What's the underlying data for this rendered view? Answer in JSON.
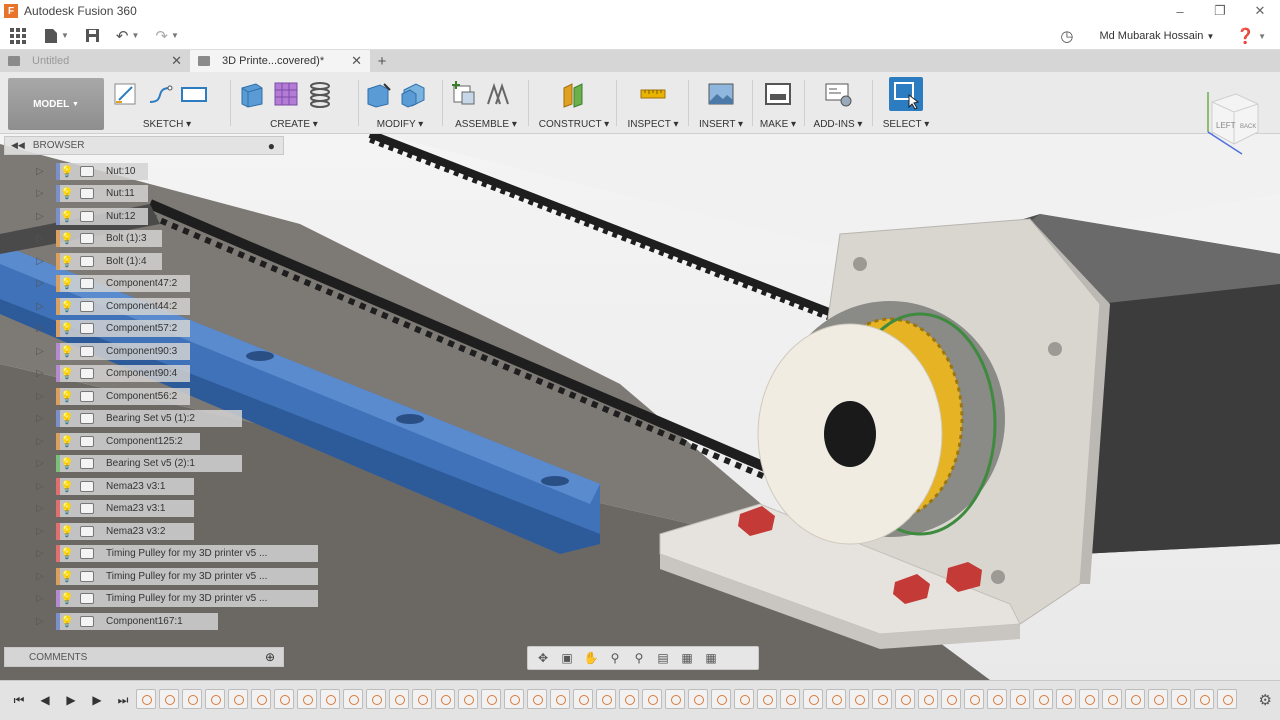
{
  "window": {
    "title": "Autodesk Fusion 360",
    "user_name": "Md Mubarak Hossain"
  },
  "tabs": [
    {
      "label": "Untitled",
      "active": false
    },
    {
      "label": "3D Printe...covered)*",
      "active": true
    }
  ],
  "ribbon": {
    "model_label": "MODEL",
    "groups": [
      {
        "label": "SKETCH"
      },
      {
        "label": "CREATE"
      },
      {
        "label": "MODIFY"
      },
      {
        "label": "ASSEMBLE"
      },
      {
        "label": "CONSTRUCT"
      },
      {
        "label": "INSPECT"
      },
      {
        "label": "INSERT"
      },
      {
        "label": "MAKE"
      },
      {
        "label": "ADD-INS"
      },
      {
        "label": "SELECT"
      }
    ]
  },
  "browser": {
    "title": "BROWSER",
    "items": [
      {
        "label": "Nut:10",
        "accent": "#7b90c8"
      },
      {
        "label": "Nut:11",
        "accent": "#7b90c8"
      },
      {
        "label": "Nut:12",
        "accent": "#7b90c8"
      },
      {
        "label": "Bolt (1):3",
        "accent": "#d9a060"
      },
      {
        "label": "Bolt (1):4",
        "accent": "#d9a060"
      },
      {
        "label": "Component47:2",
        "accent": "#d9a060"
      },
      {
        "label": "Component44:2",
        "accent": "#d9a060"
      },
      {
        "label": "Component57:2",
        "accent": "#d9a060"
      },
      {
        "label": "Component90:3",
        "accent": "#b58ad0"
      },
      {
        "label": "Component90:4",
        "accent": "#b58ad0"
      },
      {
        "label": "Component56:2",
        "accent": "#d9a060"
      },
      {
        "label": "Bearing Set v5 (1):2",
        "accent": "#7b90c8"
      },
      {
        "label": "Component125:2",
        "accent": "#d9a060"
      },
      {
        "label": "Bearing Set v5 (2):1",
        "accent": "#7bbf7b"
      },
      {
        "label": "Nema23 v3:1",
        "accent": "#e07070"
      },
      {
        "label": "Nema23 v3:1",
        "accent": "#e07070"
      },
      {
        "label": "Nema23 v3:2",
        "accent": "#e07070"
      },
      {
        "label": "Timing Pulley for my 3D printer v5 ...",
        "accent": "#e07070"
      },
      {
        "label": "Timing Pulley for my 3D printer v5 ...",
        "accent": "#d9a060"
      },
      {
        "label": "Timing Pulley for my 3D printer v5 ...",
        "accent": "#b58ad0"
      },
      {
        "label": "Component167:1",
        "accent": "#7b90c8"
      }
    ]
  },
  "comments": {
    "title": "COMMENTS"
  },
  "icons": {
    "app_logo": "fusion-logo",
    "grid": "grid-icon",
    "file": "file-icon",
    "save": "save-icon",
    "undo": "undo-icon",
    "redo": "redo-icon",
    "clock": "clock-icon",
    "help": "help-icon"
  },
  "colors": {
    "select_accent": "#2b7cc0",
    "rail_blue": "#3f72b8",
    "bolt_red": "#c43a36",
    "pulley_gold": "#e5b323"
  }
}
